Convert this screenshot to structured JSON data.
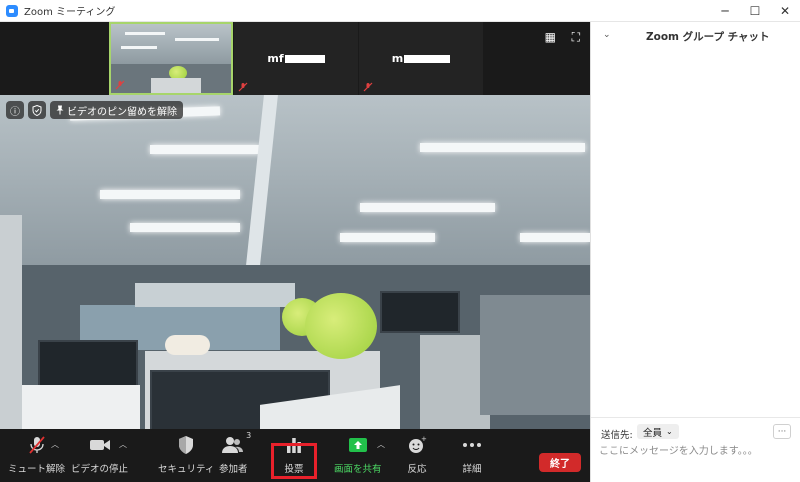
{
  "window": {
    "title": "Zoom ミーティング",
    "controls": {
      "minimize": "─",
      "maximize": "☐",
      "close": "✕"
    }
  },
  "thumbnails": [
    {
      "name": "",
      "muted": true,
      "active": true
    },
    {
      "name": "mf",
      "muted": true,
      "active": false
    },
    {
      "name": "m",
      "muted": true,
      "active": false
    }
  ],
  "video_overlay": {
    "info_icon": "ⓘ",
    "shield_icon": "shield-icon",
    "pin_label": "ビデオのピン留めを解除"
  },
  "toolbar": {
    "items": [
      {
        "key": "unmute",
        "label": "ミュート解除",
        "icon": "mic-muted-icon"
      },
      {
        "key": "video",
        "label": "ビデオの停止",
        "icon": "video-camera-icon"
      },
      {
        "key": "security",
        "label": "セキュリティ",
        "icon": "shield-icon"
      },
      {
        "key": "participants",
        "label": "参加者",
        "icon": "participants-icon",
        "count": "3"
      },
      {
        "key": "poll",
        "label": "投票",
        "icon": "poll-chart-icon"
      },
      {
        "key": "share",
        "label": "画面を共有",
        "icon": "share-screen-icon"
      },
      {
        "key": "reactions",
        "label": "反応",
        "icon": "smiley-icon"
      },
      {
        "key": "more",
        "label": "詳細",
        "icon": "more-dots-icon"
      }
    ],
    "end_label": "終了"
  },
  "chat": {
    "title": "Zoom グループ チャット",
    "send_to_label": "送信先:",
    "send_to_value": "全員",
    "more_label": "···",
    "input_placeholder": "ここにメッセージを入力します。。。"
  },
  "colors": {
    "meeting_bg": "#1a1a1a",
    "active_thumb_border": "#a7d56b",
    "end_button": "#d22a2a",
    "highlight_box": "#e8212b",
    "share_green": "#22c14b"
  }
}
